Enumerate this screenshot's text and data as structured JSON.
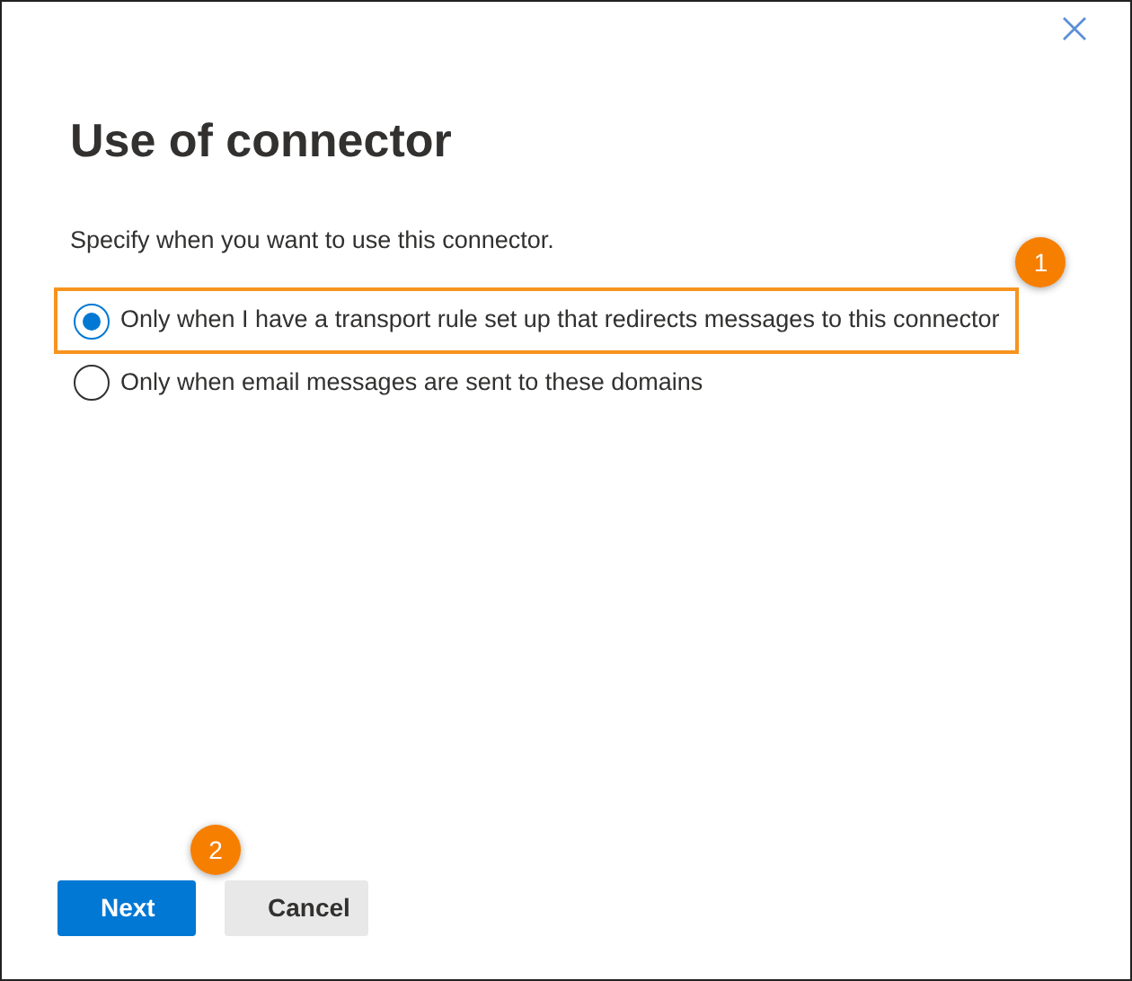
{
  "dialog": {
    "title": "Use of connector",
    "description": "Specify when you want to use this connector.",
    "options": [
      {
        "label": "Only when I have a transport rule set up that redirects messages to this connector",
        "selected": true,
        "highlighted": true,
        "callout": "1"
      },
      {
        "label": "Only when email messages are sent to these domains",
        "selected": false,
        "highlighted": false
      }
    ],
    "buttons": [
      {
        "label": "Next",
        "kind": "primary",
        "callout": "2"
      },
      {
        "label": "Cancel",
        "kind": "secondary"
      }
    ]
  }
}
